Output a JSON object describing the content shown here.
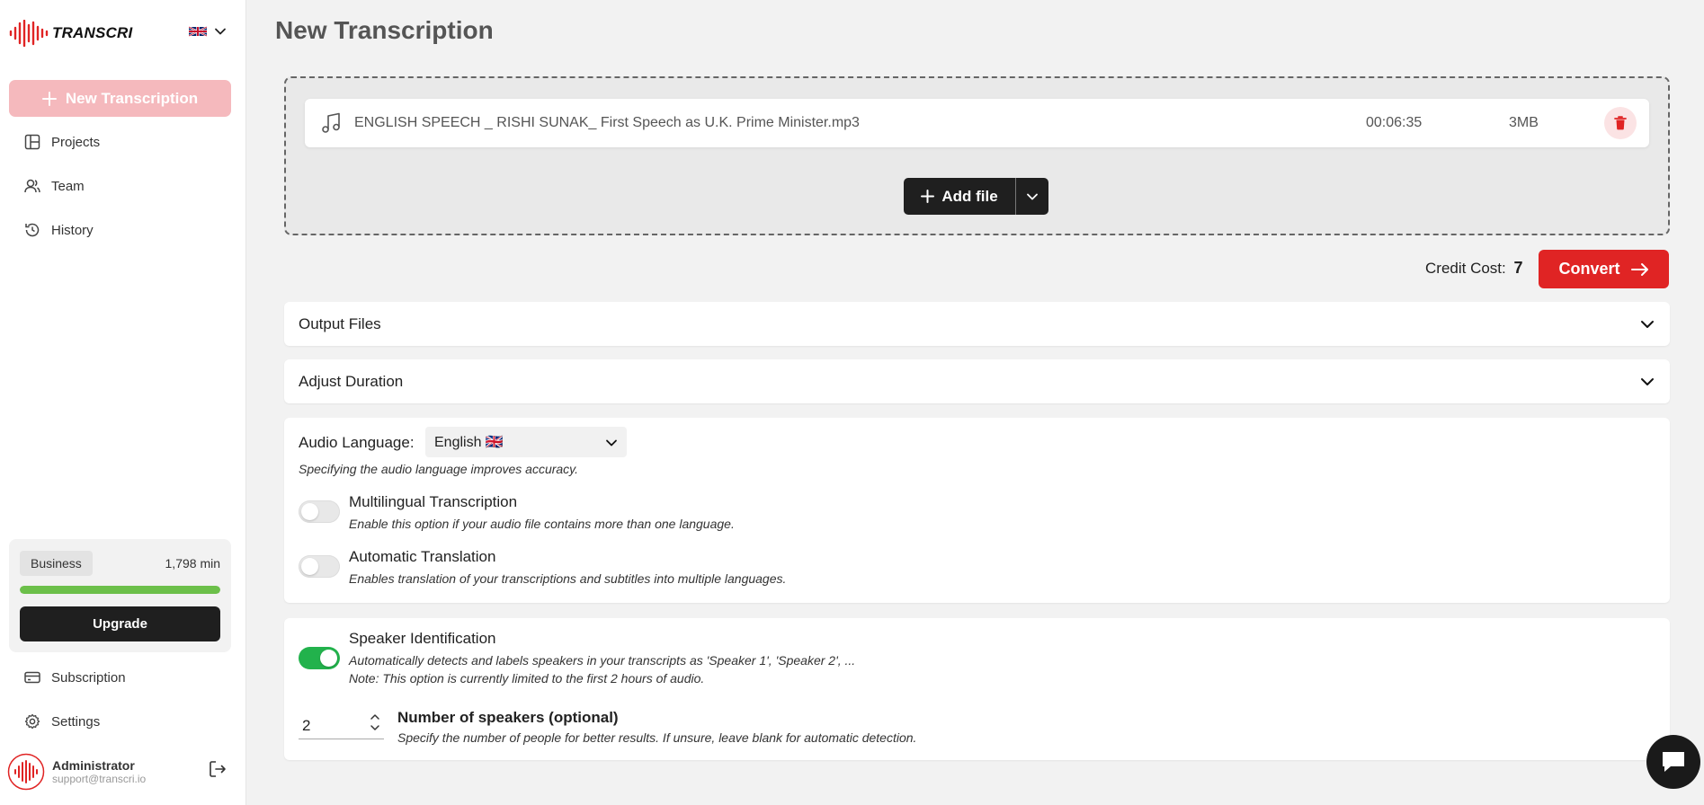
{
  "sidebar": {
    "logo_text": "TRANSCRI",
    "new_transcription_label": "New Transcription",
    "nav": [
      {
        "label": "Projects"
      },
      {
        "label": "Team"
      },
      {
        "label": "History"
      }
    ],
    "plan": {
      "name": "Business",
      "minutes": "1,798 min",
      "usage_fraction": 1.0,
      "upgrade_label": "Upgrade"
    },
    "bottom_nav": [
      {
        "label": "Subscription"
      },
      {
        "label": "Settings"
      }
    ],
    "user": {
      "name": "Administrator",
      "email": "support@transcri.io"
    }
  },
  "main": {
    "title": "New Transcription",
    "file": {
      "name": "ENGLISH SPEECH _ RISHI SUNAK_ First Speech as U.K. Prime Minister.mp3",
      "duration": "00:06:35",
      "size": "3MB"
    },
    "add_file_label": "Add file",
    "credit_label": "Credit Cost:",
    "credit_value": "7",
    "convert_label": "Convert",
    "accordions": [
      {
        "label": "Output Files"
      },
      {
        "label": "Adjust Duration"
      }
    ],
    "language": {
      "label": "Audio Language:",
      "selected": "English 🇬🇧",
      "hint": "Specifying the audio language improves accuracy."
    },
    "multilingual": {
      "title": "Multilingual Transcription",
      "desc": "Enable this option if your audio file contains more than one language.",
      "enabled": false
    },
    "translation": {
      "title": "Automatic Translation",
      "desc": "Enables translation of your transcriptions and subtitles into multiple languages.",
      "enabled": false
    },
    "speaker": {
      "title": "Speaker Identification",
      "desc": "Automatically detects and labels speakers in your transcripts as 'Speaker 1', 'Speaker 2', ...",
      "note": "Note: This option is currently limited to the first 2 hours of audio.",
      "enabled": true
    },
    "speakers_count": {
      "value": "2",
      "title": "Number of speakers (optional)",
      "desc": "Specify the number of people for better results. If unsure, leave blank for automatic detection."
    }
  },
  "colors": {
    "accent": "#e02424",
    "accent_light": "#f5b9bd",
    "toggle_on": "#22b24c",
    "progress": "#6cc04a",
    "dark": "#1f1f1f"
  },
  "icons": {
    "logo": "soundwave-icon",
    "flag": "uk-flag-icon",
    "file": "music-note-icon",
    "delete": "trash-icon",
    "chat": "chat-bubble-icon"
  }
}
